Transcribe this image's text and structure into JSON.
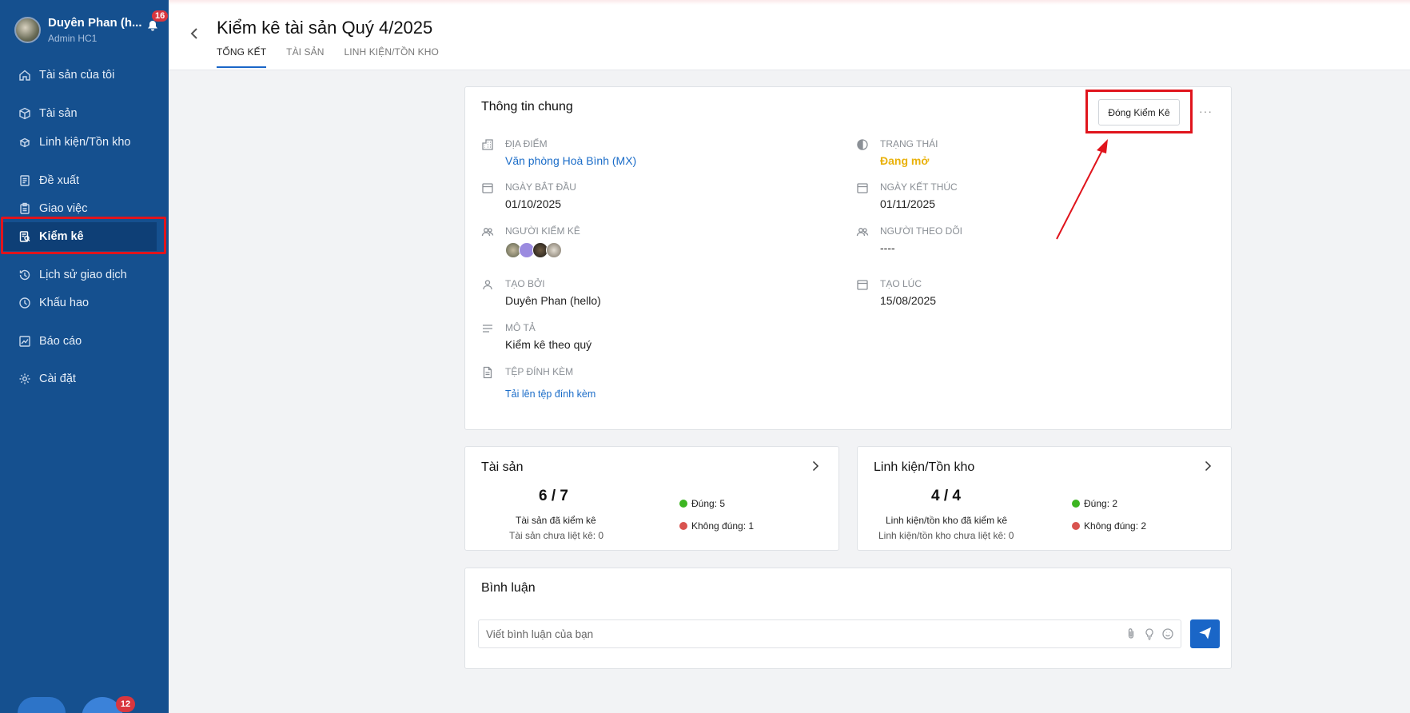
{
  "sidebar": {
    "user_name": "Duyên Phan (h...",
    "user_role": "Admin HC1",
    "notification_count": "16",
    "items": [
      {
        "label": "Tài sản của tôi",
        "icon": "home-icon"
      },
      {
        "label": "Tài sản",
        "icon": "box-icon"
      },
      {
        "label": "Linh kiện/Tồn kho",
        "icon": "components-icon"
      },
      {
        "label": "Đề xuất",
        "icon": "document-icon"
      },
      {
        "label": "Giao việc",
        "icon": "clipboard-icon"
      },
      {
        "label": "Kiểm kê",
        "icon": "inventory-check-icon",
        "active": true
      },
      {
        "label": "Lịch sử giao dịch",
        "icon": "history-icon"
      },
      {
        "label": "Khấu hao",
        "icon": "clock-icon"
      },
      {
        "label": "Báo cáo",
        "icon": "chart-icon"
      },
      {
        "label": "Cài đặt",
        "icon": "gear-icon"
      }
    ],
    "bottom_badge": "12"
  },
  "header": {
    "title": "Kiểm kê tài sản Quý 4/2025",
    "tabs": [
      "TỔNG KẾT",
      "TÀI SẢN",
      "LINH KIỆN/TỒN KHO"
    ],
    "active_tab": "TỔNG KẾT"
  },
  "info": {
    "title": "Thông tin chung",
    "close_button": "Đóng Kiểm Kê",
    "more": "···",
    "location_label": "ĐỊA ĐIỂM",
    "location_value": "Văn phòng Hoà Bình (MX)",
    "status_label": "TRẠNG THÁI",
    "status_value": "Đang mở",
    "start_label": "NGÀY BẮT ĐẦU",
    "start_value": "01/10/2025",
    "end_label": "NGÀY KẾT THÚC",
    "end_value": "01/11/2025",
    "auditors_label": "NGƯỜI KIỂM KÊ",
    "followers_label": "NGƯỜI THEO DÕI",
    "followers_value": "----",
    "created_by_label": "TẠO BỞI",
    "created_by_value": "Duyên Phan (hello)",
    "created_at_label": "TẠO LÚC",
    "created_at_value": "15/08/2025",
    "description_label": "MÔ TẢ",
    "description_value": "Kiểm kê theo quý",
    "attachment_label": "TỆP ĐÍNH KÈM",
    "attachment_link": "Tải lên tệp đính kèm"
  },
  "assets_card": {
    "title": "Tài sản",
    "count": "6 / 7",
    "checked_label": "Tài sản đã kiểm kê",
    "unlisted_label": "Tài sản chưa liệt kê: 0",
    "correct": "Đúng: 5",
    "incorrect": "Không đúng: 1"
  },
  "parts_card": {
    "title": "Linh kiện/Tồn kho",
    "count": "4 / 4",
    "checked_label": "Linh kiện/tồn kho đã kiểm kê",
    "unlisted_label": "Linh kiện/tồn kho chưa liệt kê: 0",
    "correct": "Đúng: 2",
    "incorrect": "Không đúng: 2"
  },
  "comments": {
    "title": "Bình luận",
    "placeholder": "Viết bình luận của bạn"
  },
  "colors": {
    "sidebar_bg": "#15508f",
    "accent": "#1a66c7",
    "status_open": "#e9b10a",
    "correct": "#3cb521",
    "incorrect": "#d9534f",
    "highlight": "#e0141c"
  }
}
